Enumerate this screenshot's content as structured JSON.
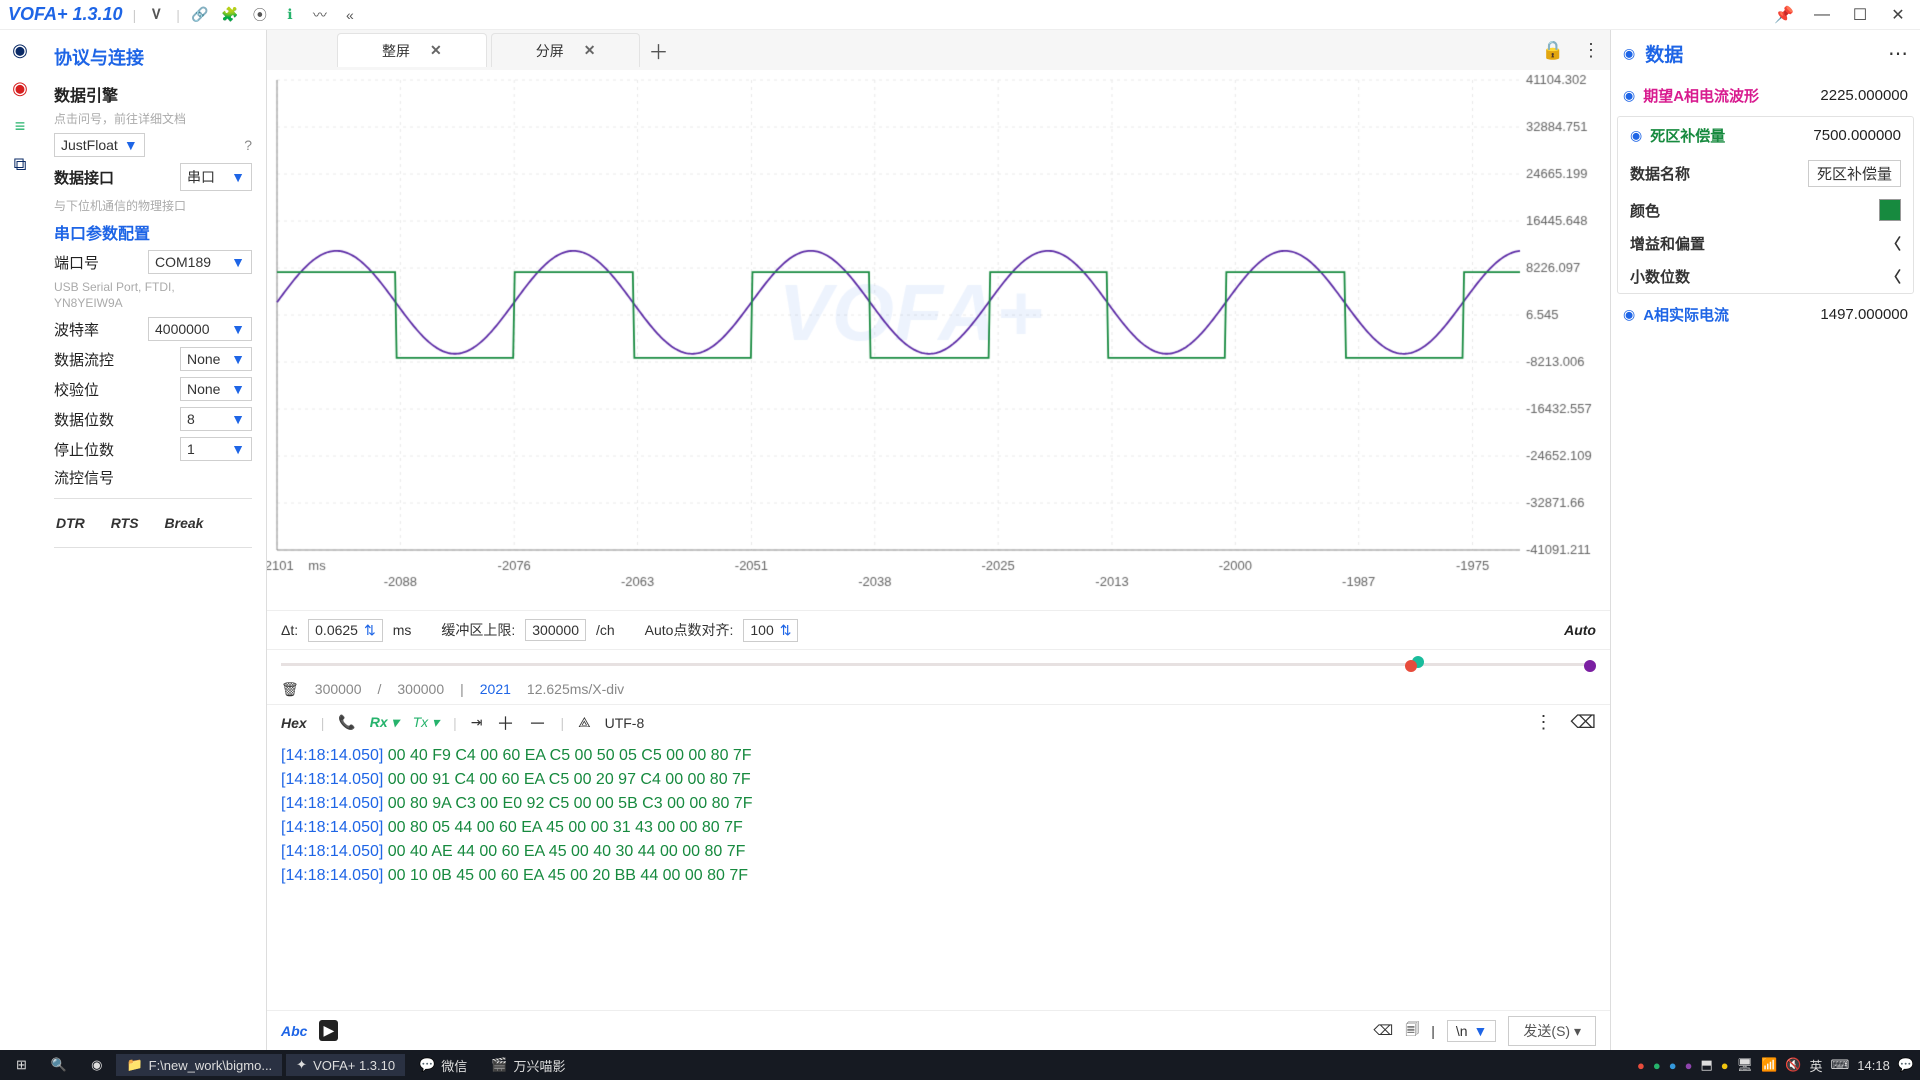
{
  "app": {
    "name": "VOFA+ 1.3.10"
  },
  "winbtns": {
    "pin": "📌",
    "min": "—",
    "max": "☐",
    "close": "✕"
  },
  "left": {
    "title": "协议与连接",
    "engine_label": "数据引擎",
    "engine_hint": "点击问号，前往详细文档",
    "engine_value": "JustFloat",
    "iface_label": "数据接口",
    "iface_value": "串口",
    "iface_hint": "与下位机通信的物理接口",
    "serial_title": "串口参数配置",
    "port_label": "端口号",
    "port_value": "COM189",
    "port_desc1": "USB Serial Port, FTDI,",
    "port_desc2": "YN8YEIW9A",
    "baud_label": "波特率",
    "baud_value": "4000000",
    "flow_label": "数据流控",
    "flow_value": "None",
    "parity_label": "校验位",
    "parity_value": "None",
    "databits_label": "数据位数",
    "databits_value": "8",
    "stopbits_label": "停止位数",
    "stopbits_value": "1",
    "flowsig_label": "流控信号",
    "dtrrts": {
      "a": "DTR",
      "b": "RTS",
      "c": "Break"
    }
  },
  "tabs": {
    "t1": "整屏",
    "t2": "分屏"
  },
  "chart_data": {
    "type": "line",
    "xlabel": "ms",
    "x_ticks": [
      -2101,
      -2088,
      -2076,
      -2063,
      -2051,
      -2038,
      -2025,
      -2013,
      -2000,
      -1987,
      -1975
    ],
    "y_ticks": [
      41104.302,
      32884.751,
      24665.199,
      16445.648,
      8226.097,
      6.545,
      -8213.006,
      -16432.557,
      -24652.109,
      -32871.66,
      -41091.211
    ],
    "ylim": [
      -41091.211,
      41104.302
    ],
    "xlim": [
      -2101,
      -1970
    ],
    "series": [
      {
        "name": "期望A相电流波形",
        "color": "#5b2aa5",
        "shape": "sine",
        "amplitude": 9000,
        "offset": 2225,
        "period_ms": 25,
        "phase": 0
      },
      {
        "name": "死区补偿量",
        "color": "#178a3f",
        "shape": "square",
        "amplitude": 7500,
        "offset": 0,
        "period_ms": 25,
        "phase": 0
      }
    ]
  },
  "ctrl": {
    "dt_label": "Δt:",
    "dt_value": "0.0625",
    "dt_unit": "ms",
    "buf_label": "缓冲区上限:",
    "buf_value": "300000",
    "buf_unit": "/ch",
    "autoN_label": "Auto点数对齐:",
    "autoN_value": "100",
    "auto": "Auto"
  },
  "bufstat": {
    "a": "300000",
    "b": "/",
    "c": "300000",
    "d": "|",
    "e": "2021",
    "f": "12.625ms/X-div"
  },
  "logbar": {
    "hex": "Hex",
    "rx": "Rx",
    "tx": "Tx",
    "enc": "UTF-8"
  },
  "log": [
    {
      "t": "[14:18:14.050]",
      "d": "00 40 F9 C4 00 60 EA C5 00 50 05 C5 00 00 80 7F"
    },
    {
      "t": "[14:18:14.050]",
      "d": "00 00 91 C4 00 60 EA C5 00 20 97 C4 00 00 80 7F"
    },
    {
      "t": "[14:18:14.050]",
      "d": "00 80 9A C3 00 E0 92 C5 00 00 5B C3 00 00 80 7F"
    },
    {
      "t": "[14:18:14.050]",
      "d": "00 80 05 44 00 60 EA 45 00 00 31 43 00 00 80 7F"
    },
    {
      "t": "[14:18:14.050]",
      "d": "00 40 AE 44 00 60 EA 45 00 40 30 44 00 00 80 7F"
    },
    {
      "t": "[14:18:14.050]",
      "d": "00 10 0B 45 00 60 EA 45 00 20 BB 44 00 00 80 7F"
    }
  ],
  "send": {
    "abc": "Abc",
    "nl": "\\n",
    "btn": "发送(S)"
  },
  "right": {
    "title": "数据",
    "items": [
      {
        "name": "期望A相电流波形",
        "val": "2225.000000",
        "cls": "magenta"
      },
      {
        "name": "死区补偿量",
        "val": "7500.000000",
        "cls": "green"
      },
      {
        "name": "A相实际电流",
        "val": "1497.000000",
        "cls": "blue"
      }
    ],
    "props": {
      "data_name_label": "数据名称",
      "data_name_value": "死区补偿量",
      "color_label": "颜色",
      "gain_label": "增益和偏置",
      "decimals_label": "小数位数"
    }
  },
  "taskbar": {
    "path": "F:\\new_work\\bigmo...",
    "vofa": "VOFA+ 1.3.10",
    "wechat": "微信",
    "wx2": "万兴喵影",
    "ime": "英",
    "kb": "⌨",
    "time": "14:18"
  }
}
